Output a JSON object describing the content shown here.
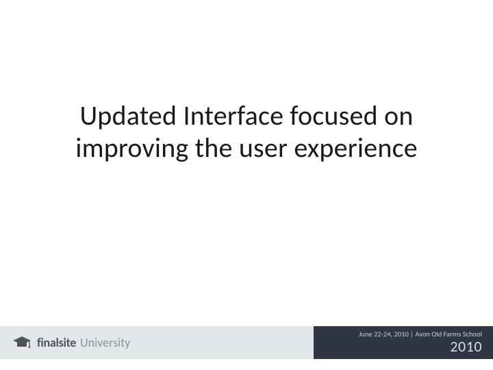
{
  "title": {
    "line1": "Updated Interface focused on",
    "line2": "improving the user experience"
  },
  "footer": {
    "brand": {
      "icon": "mortarboard-icon",
      "name_strong": "finalsite",
      "name_light": "University"
    },
    "event": {
      "date_venue": "June 22-24, 2010 | Avon Old Farms School",
      "year": "2010"
    }
  },
  "colors": {
    "footer_left_bg": "#e4e7ea",
    "footer_right_bg": "#2f3542",
    "brand_dark": "#4a5560",
    "brand_light": "#8a9199"
  }
}
